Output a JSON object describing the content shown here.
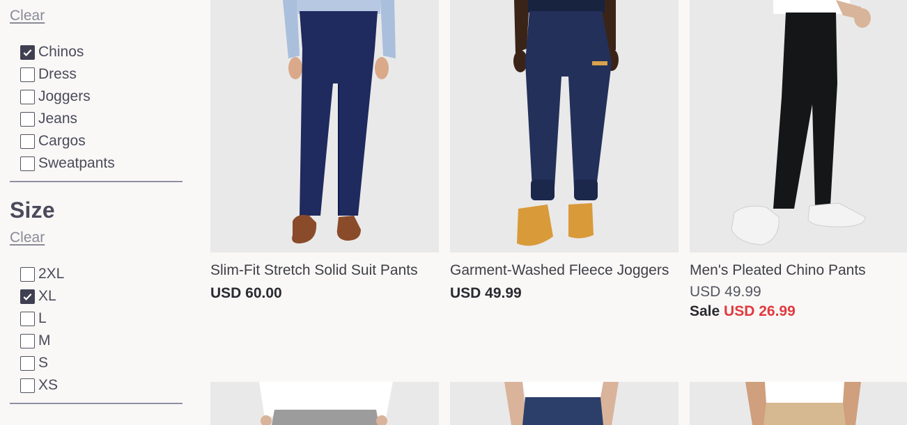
{
  "filters": {
    "type": {
      "clear_label": "Clear",
      "options": [
        {
          "label": "Chinos",
          "checked": true
        },
        {
          "label": "Dress",
          "checked": false
        },
        {
          "label": "Joggers",
          "checked": false
        },
        {
          "label": "Jeans",
          "checked": false
        },
        {
          "label": "Cargos",
          "checked": false
        },
        {
          "label": "Sweatpants",
          "checked": false
        }
      ]
    },
    "size": {
      "title": "Size",
      "clear_label": "Clear",
      "options": [
        {
          "label": "2XL",
          "checked": false
        },
        {
          "label": "XL",
          "checked": true
        },
        {
          "label": "L",
          "checked": false
        },
        {
          "label": "M",
          "checked": false
        },
        {
          "label": "S",
          "checked": false
        },
        {
          "label": "XS",
          "checked": false
        }
      ]
    }
  },
  "products": [
    {
      "name": "Slim-Fit Stretch Solid Suit Pants",
      "price": "USD 60.00"
    },
    {
      "name": "Garment-Washed Fleece Joggers",
      "price": "USD 49.99"
    },
    {
      "name": "Men's Pleated Chino Pants",
      "original_price": "USD 49.99",
      "sale_label": "Sale",
      "sale_price": "USD 26.99"
    }
  ],
  "colors": {
    "sale": "#e0393e",
    "checkbox_checked": "#3f3f52",
    "photo_bg": "#e9e9e9"
  }
}
